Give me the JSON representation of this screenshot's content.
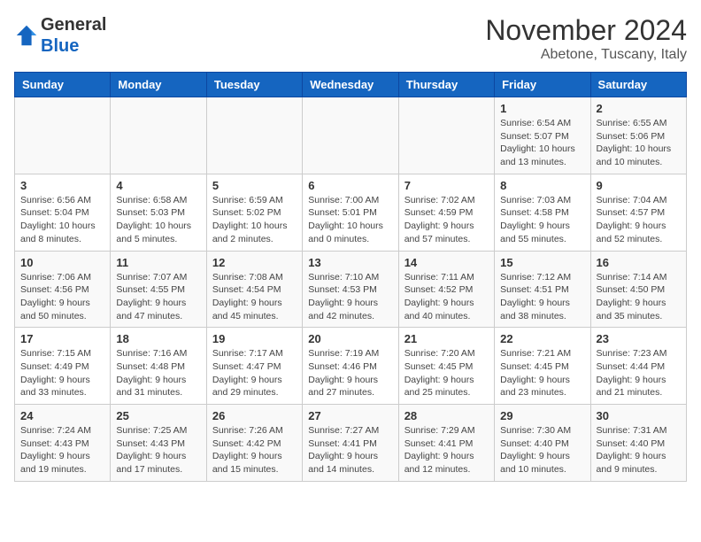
{
  "header": {
    "logo_line1": "General",
    "logo_line2": "Blue",
    "month_title": "November 2024",
    "location": "Abetone, Tuscany, Italy"
  },
  "weekdays": [
    "Sunday",
    "Monday",
    "Tuesday",
    "Wednesday",
    "Thursday",
    "Friday",
    "Saturday"
  ],
  "weeks": [
    [
      {
        "day": "",
        "info": ""
      },
      {
        "day": "",
        "info": ""
      },
      {
        "day": "",
        "info": ""
      },
      {
        "day": "",
        "info": ""
      },
      {
        "day": "",
        "info": ""
      },
      {
        "day": "1",
        "info": "Sunrise: 6:54 AM\nSunset: 5:07 PM\nDaylight: 10 hours and 13 minutes."
      },
      {
        "day": "2",
        "info": "Sunrise: 6:55 AM\nSunset: 5:06 PM\nDaylight: 10 hours and 10 minutes."
      }
    ],
    [
      {
        "day": "3",
        "info": "Sunrise: 6:56 AM\nSunset: 5:04 PM\nDaylight: 10 hours and 8 minutes."
      },
      {
        "day": "4",
        "info": "Sunrise: 6:58 AM\nSunset: 5:03 PM\nDaylight: 10 hours and 5 minutes."
      },
      {
        "day": "5",
        "info": "Sunrise: 6:59 AM\nSunset: 5:02 PM\nDaylight: 10 hours and 2 minutes."
      },
      {
        "day": "6",
        "info": "Sunrise: 7:00 AM\nSunset: 5:01 PM\nDaylight: 10 hours and 0 minutes."
      },
      {
        "day": "7",
        "info": "Sunrise: 7:02 AM\nSunset: 4:59 PM\nDaylight: 9 hours and 57 minutes."
      },
      {
        "day": "8",
        "info": "Sunrise: 7:03 AM\nSunset: 4:58 PM\nDaylight: 9 hours and 55 minutes."
      },
      {
        "day": "9",
        "info": "Sunrise: 7:04 AM\nSunset: 4:57 PM\nDaylight: 9 hours and 52 minutes."
      }
    ],
    [
      {
        "day": "10",
        "info": "Sunrise: 7:06 AM\nSunset: 4:56 PM\nDaylight: 9 hours and 50 minutes."
      },
      {
        "day": "11",
        "info": "Sunrise: 7:07 AM\nSunset: 4:55 PM\nDaylight: 9 hours and 47 minutes."
      },
      {
        "day": "12",
        "info": "Sunrise: 7:08 AM\nSunset: 4:54 PM\nDaylight: 9 hours and 45 minutes."
      },
      {
        "day": "13",
        "info": "Sunrise: 7:10 AM\nSunset: 4:53 PM\nDaylight: 9 hours and 42 minutes."
      },
      {
        "day": "14",
        "info": "Sunrise: 7:11 AM\nSunset: 4:52 PM\nDaylight: 9 hours and 40 minutes."
      },
      {
        "day": "15",
        "info": "Sunrise: 7:12 AM\nSunset: 4:51 PM\nDaylight: 9 hours and 38 minutes."
      },
      {
        "day": "16",
        "info": "Sunrise: 7:14 AM\nSunset: 4:50 PM\nDaylight: 9 hours and 35 minutes."
      }
    ],
    [
      {
        "day": "17",
        "info": "Sunrise: 7:15 AM\nSunset: 4:49 PM\nDaylight: 9 hours and 33 minutes."
      },
      {
        "day": "18",
        "info": "Sunrise: 7:16 AM\nSunset: 4:48 PM\nDaylight: 9 hours and 31 minutes."
      },
      {
        "day": "19",
        "info": "Sunrise: 7:17 AM\nSunset: 4:47 PM\nDaylight: 9 hours and 29 minutes."
      },
      {
        "day": "20",
        "info": "Sunrise: 7:19 AM\nSunset: 4:46 PM\nDaylight: 9 hours and 27 minutes."
      },
      {
        "day": "21",
        "info": "Sunrise: 7:20 AM\nSunset: 4:45 PM\nDaylight: 9 hours and 25 minutes."
      },
      {
        "day": "22",
        "info": "Sunrise: 7:21 AM\nSunset: 4:45 PM\nDaylight: 9 hours and 23 minutes."
      },
      {
        "day": "23",
        "info": "Sunrise: 7:23 AM\nSunset: 4:44 PM\nDaylight: 9 hours and 21 minutes."
      }
    ],
    [
      {
        "day": "24",
        "info": "Sunrise: 7:24 AM\nSunset: 4:43 PM\nDaylight: 9 hours and 19 minutes."
      },
      {
        "day": "25",
        "info": "Sunrise: 7:25 AM\nSunset: 4:43 PM\nDaylight: 9 hours and 17 minutes."
      },
      {
        "day": "26",
        "info": "Sunrise: 7:26 AM\nSunset: 4:42 PM\nDaylight: 9 hours and 15 minutes."
      },
      {
        "day": "27",
        "info": "Sunrise: 7:27 AM\nSunset: 4:41 PM\nDaylight: 9 hours and 14 minutes."
      },
      {
        "day": "28",
        "info": "Sunrise: 7:29 AM\nSunset: 4:41 PM\nDaylight: 9 hours and 12 minutes."
      },
      {
        "day": "29",
        "info": "Sunrise: 7:30 AM\nSunset: 4:40 PM\nDaylight: 9 hours and 10 minutes."
      },
      {
        "day": "30",
        "info": "Sunrise: 7:31 AM\nSunset: 4:40 PM\nDaylight: 9 hours and 9 minutes."
      }
    ]
  ]
}
